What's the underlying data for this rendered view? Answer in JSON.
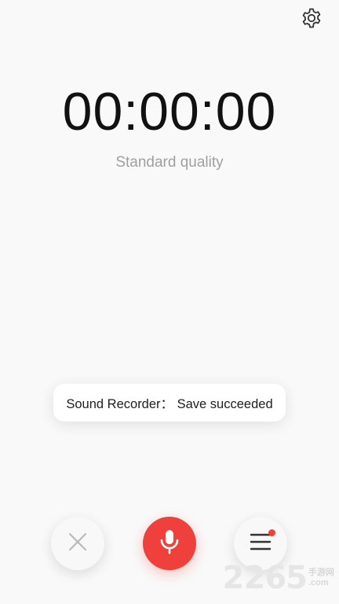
{
  "header": {
    "settings_icon": "gear-icon"
  },
  "recorder": {
    "timer": "00:00:00",
    "quality": "Standard quality"
  },
  "toast": {
    "message": "Sound Recorder： Save succeeded"
  },
  "controls": {
    "cancel_icon": "close-icon",
    "record_icon": "microphone-icon",
    "list_icon": "menu-list-icon",
    "record_color": "#f0403b",
    "badge_color": "#f0403b"
  },
  "watermark": {
    "number": "2265",
    "suffix_top": "手游网",
    "suffix_bottom": ".com"
  }
}
